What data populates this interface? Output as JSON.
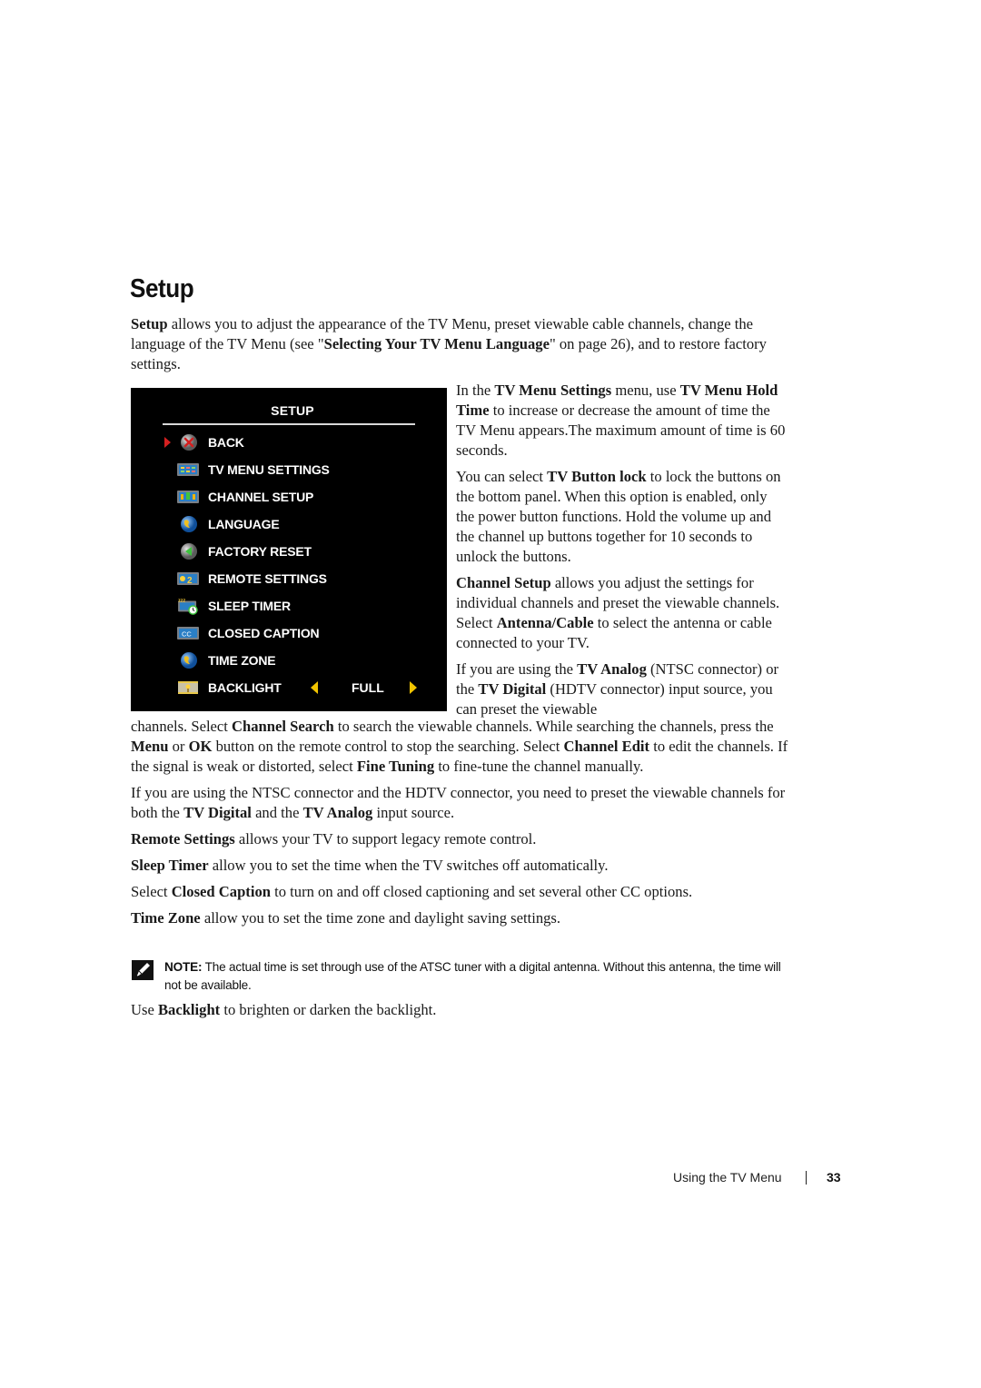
{
  "page": {
    "title": "Setup",
    "intro": {
      "t1_b": "Setup",
      "t1": " allows you to adjust the appearance of the TV Menu, preset viewable cable channels, change the language of the TV Menu (see \"",
      "t2_b": "Selecting Your TV Menu Language",
      "t2": "\" on page 26), and to restore factory settings."
    },
    "tv_menu": {
      "header": "SETUP",
      "items": [
        {
          "label": "BACK",
          "icon": "back-x-icon",
          "selected": true
        },
        {
          "label": "TV MENU SETTINGS",
          "icon": "tv-menu-settings-icon"
        },
        {
          "label": "CHANNEL SETUP",
          "icon": "channel-setup-icon"
        },
        {
          "label": "LANGUAGE",
          "icon": "globe-icon"
        },
        {
          "label": "FACTORY RESET",
          "icon": "factory-reset-icon"
        },
        {
          "label": "REMOTE SETTINGS",
          "icon": "remote-settings-icon"
        },
        {
          "label": "SLEEP TIMER",
          "icon": "sleep-timer-icon"
        },
        {
          "label": "CLOSED CAPTION",
          "icon": "closed-caption-icon"
        },
        {
          "label": "TIME ZONE",
          "icon": "globe-icon"
        },
        {
          "label": "BACKLIGHT",
          "icon": "backlight-icon",
          "value": "FULL"
        }
      ],
      "cc_text": "CC",
      "colors": {
        "background": "#000000",
        "selector": "#d42020",
        "arrows": "#f2c400",
        "text": "#ffffff"
      }
    },
    "right_col": {
      "p1": {
        "a": "In the ",
        "b1": "TV Menu Settings",
        "c": " menu, use ",
        "b2": "TV Menu Hold Time",
        "d": " to increase or decrease the amount of time the TV Menu appears.The maximum amount of time is 60 seconds."
      },
      "p2": {
        "a": "You can select ",
        "b1": "TV Button lock",
        "c": " to lock the buttons on the bottom panel. When this option is enabled, only the power button functions. Hold the volume up and the channel up buttons together for 10 seconds to unlock the buttons."
      },
      "p3": {
        "b1": "Channel Setup",
        "a": " allows you adjust the settings for individual channels and preset the viewable channels. Select ",
        "b2": "Antenna/Cable",
        "c": " to select the antenna or cable connected to your TV."
      },
      "p4": {
        "a": "If you are using the ",
        "b1": "TV Analog",
        "c": " (NTSC connector) or the ",
        "b2": "TV Digital",
        "d": " (HDTV connector) input source, you can preset the viewable"
      }
    },
    "after": {
      "p1": {
        "a": "channels. Select ",
        "b1": "Channel Search",
        "c": " to search the viewable channels. While searching the channels, press the ",
        "b2": "Menu",
        "d": " or ",
        "b3": "OK",
        "e": " button on the remote control to stop the searching. Select ",
        "b4": "Channel Edit",
        "f": " to edit the channels. If the signal is weak or distorted, select ",
        "b5": "Fine Tuning",
        "g": " to fine-tune the channel manually."
      },
      "p2": {
        "a": "If you are using the NTSC connector and the HDTV connector, you need to preset the viewable channels for both the ",
        "b1": "TV Digital",
        "c": " and the ",
        "b2": "TV Analog",
        "d": " input source."
      },
      "p3": {
        "b1": "Remote Settings",
        "a": " allows your TV to support legacy remote control."
      },
      "p4": {
        "b1": "Sleep Timer",
        "a": " allow you to set the time when the TV switches off automatically."
      },
      "p5": {
        "a": "Select ",
        "b1": "Closed Caption",
        "c": " to turn on and off closed captioning and set several other CC options."
      },
      "p6": {
        "b1": "Time Zone",
        "a": " allow you to set the time zone and daylight saving settings."
      }
    },
    "note": {
      "label": "NOTE:",
      "text": " The actual time is set through use of the ATSC tuner with a digital antenna.  Without this antenna, the time will not be available.",
      "icon": "note-pencil-icon"
    },
    "backlight_p": {
      "a": "Use ",
      "b1": "Backlight",
      "c": " to brighten or darken the backlight."
    },
    "footer": {
      "section": "Using the TV Menu",
      "page_number": "33"
    }
  }
}
